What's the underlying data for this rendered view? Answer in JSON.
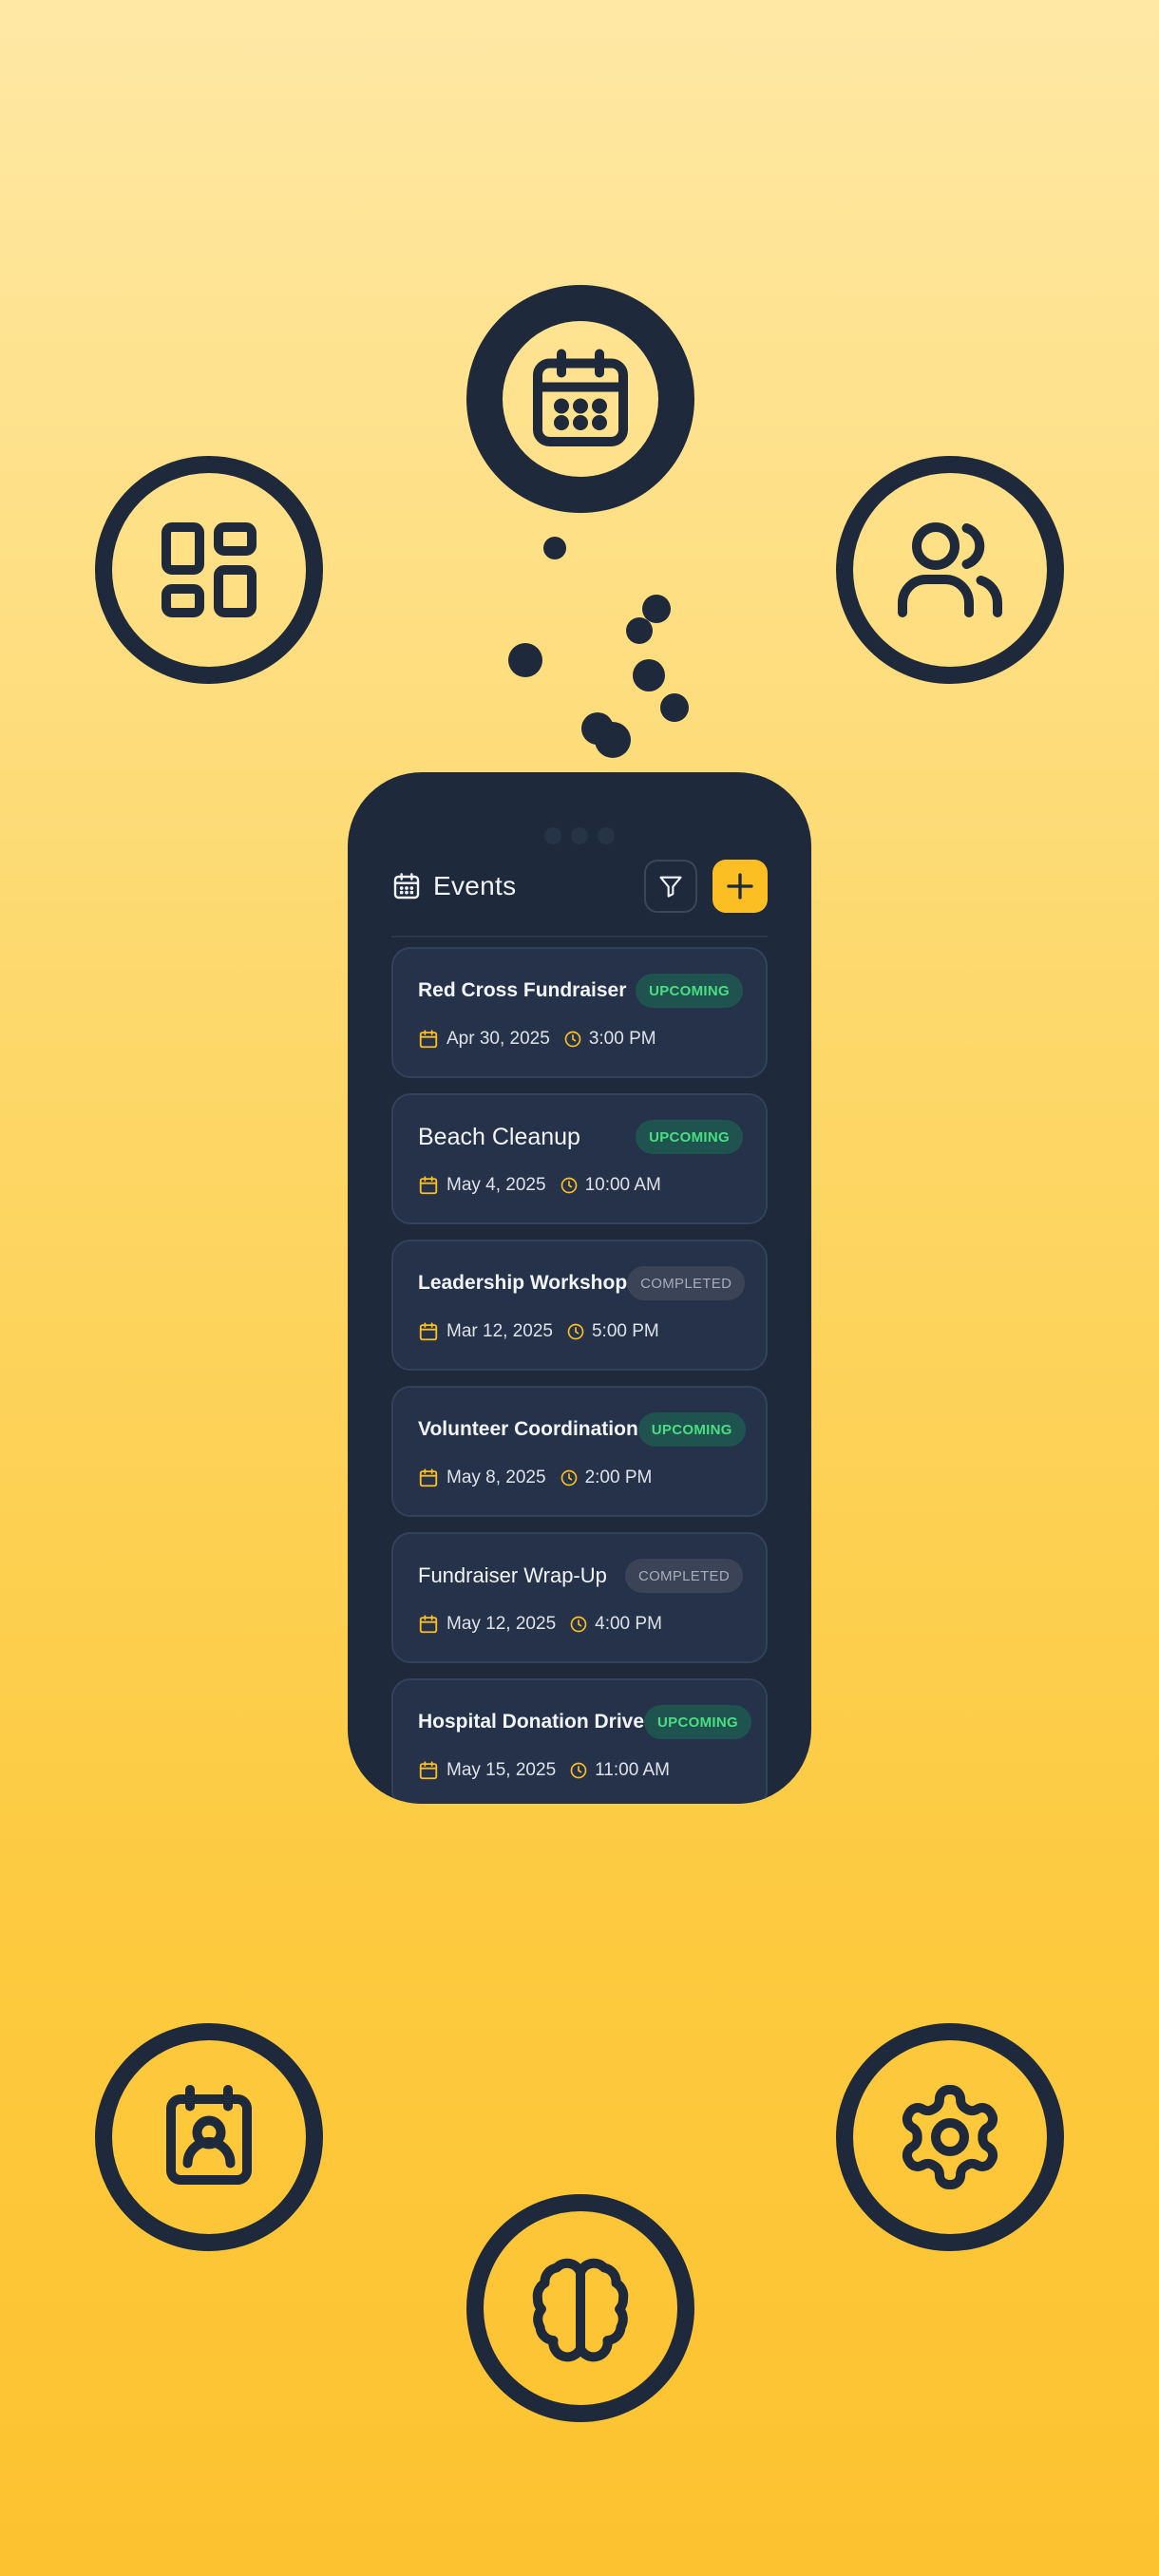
{
  "header": {
    "title": "Events"
  },
  "icons": {
    "header": "calendar-icon",
    "filter": "filter-icon",
    "add": "plus-icon",
    "floating": [
      "calendar-icon",
      "dashboard-icon",
      "users-icon",
      "contact-icon",
      "settings-icon",
      "brain-icon"
    ]
  },
  "colors": {
    "accent": "#fbbf24",
    "dark": "#1e293b",
    "upcoming": "#4ade80"
  },
  "events": [
    {
      "name": "Red Cross Fundraiser",
      "status": "UPCOMING",
      "date": "Apr 30, 2025",
      "time": "3:00 PM"
    },
    {
      "name": "Beach Cleanup",
      "status": "UPCOMING",
      "date": "May 4, 2025",
      "time": "10:00 AM"
    },
    {
      "name": "Leadership Workshop",
      "status": "COMPLETED",
      "date": "Mar 12, 2025",
      "time": "5:00 PM"
    },
    {
      "name": "Volunteer Coordination",
      "status": "UPCOMING",
      "date": "May 8, 2025",
      "time": "2:00 PM"
    },
    {
      "name": "Fundraiser Wrap-Up",
      "status": "COMPLETED",
      "date": "May 12, 2025",
      "time": "4:00 PM"
    },
    {
      "name": "Hospital Donation Drive",
      "status": "UPCOMING",
      "date": "May 15, 2025",
      "time": "11:00 AM"
    }
  ]
}
